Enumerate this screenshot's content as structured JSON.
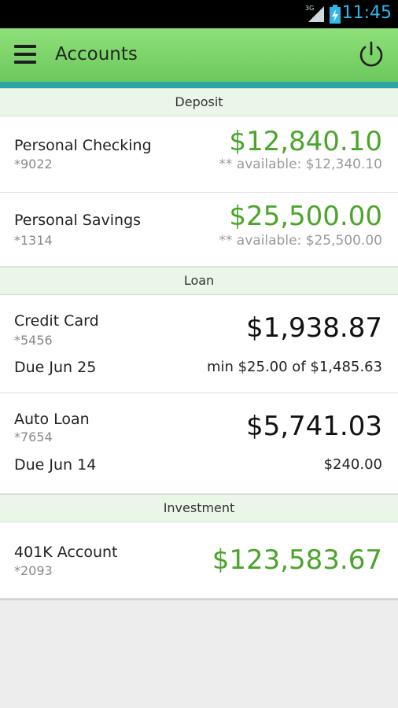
{
  "status_bar": {
    "network": "3G",
    "time": "11:45"
  },
  "header": {
    "title": "Accounts"
  },
  "sections": {
    "deposit": {
      "title": "Deposit",
      "accounts": [
        {
          "name": "Personal Checking",
          "number": "*9022",
          "balance": "$12,840.10",
          "available": "** available: $12,340.10"
        },
        {
          "name": "Personal Savings",
          "number": "*1314",
          "balance": "$25,500.00",
          "available": "** available: $25,500.00"
        }
      ]
    },
    "loan": {
      "title": "Loan",
      "accounts": [
        {
          "name": "Credit Card",
          "number": "*5456",
          "balance": "$1,938.87",
          "due": "Due Jun 25",
          "payment": "min $25.00 of $1,485.63"
        },
        {
          "name": "Auto Loan",
          "number": "*7654",
          "balance": "$5,741.03",
          "due": "Due Jun 14",
          "payment": "$240.00"
        }
      ]
    },
    "investment": {
      "title": "Investment",
      "accounts": [
        {
          "name": "401K Account",
          "number": "*2093",
          "balance": "$123,583.67"
        }
      ]
    }
  },
  "colors": {
    "accent_green": "#4aa52a",
    "app_bar": "#7ad468",
    "teal_strip": "#2aa6a8",
    "section_bg": "#eaf6e8"
  }
}
